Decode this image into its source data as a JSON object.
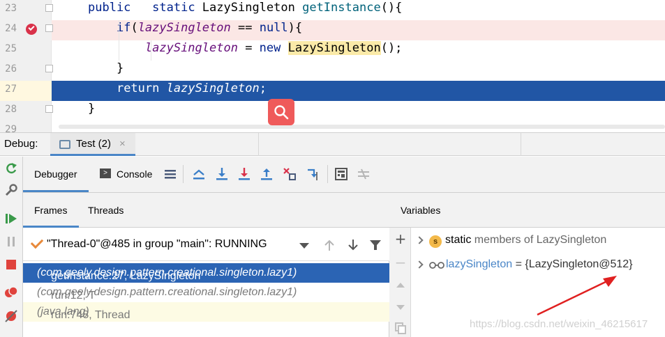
{
  "editor": {
    "lines": [
      {
        "num": "23",
        "parts": [
          [
            "kw",
            "public"
          ],
          [
            "",
            "   "
          ],
          [
            "kw",
            "static"
          ],
          [
            "",
            " LazySingleton "
          ],
          [
            "meth",
            "getInstance"
          ],
          [
            "",
            "(){"
          ]
        ]
      },
      {
        "num": "24",
        "parts": [
          [
            "",
            "    "
          ],
          [
            "kw",
            "if"
          ],
          [
            "",
            "("
          ],
          [
            "var",
            "lazySingleton"
          ],
          [
            "",
            " == "
          ],
          [
            "kw",
            "null"
          ],
          [
            "",
            "){"
          ]
        ]
      },
      {
        "num": "25",
        "parts": [
          [
            "",
            "        "
          ],
          [
            "var",
            "lazySingleton"
          ],
          [
            "",
            " = "
          ],
          [
            "kw",
            "new"
          ],
          [
            "",
            " "
          ],
          [
            "hl",
            "LazySingleton"
          ],
          [
            "",
            "();"
          ]
        ]
      },
      {
        "num": "26",
        "parts": [
          [
            "",
            "    }"
          ]
        ]
      },
      {
        "num": "27",
        "parts": [
          [
            "",
            "    "
          ],
          [
            "kw",
            "return"
          ],
          [
            "",
            " "
          ],
          [
            "var",
            "lazySingleton"
          ],
          [
            "",
            ";"
          ]
        ]
      },
      {
        "num": "28",
        "parts": [
          [
            "",
            "}"
          ]
        ]
      },
      {
        "num": "29",
        "parts": []
      }
    ],
    "breakpoint_line": "24",
    "execution_line": "27"
  },
  "debug": {
    "label": "Debug:",
    "session_tab": "Test (2)",
    "session_close": "×",
    "tabs": {
      "debugger": "Debugger",
      "console": "Console"
    }
  },
  "frames": {
    "tabs": {
      "frames": "Frames",
      "threads": "Threads"
    },
    "thread": "\"Thread-0\"@485 in group \"main\": RUNNING",
    "items": [
      {
        "method": "getInstance:27, LazySingleton ",
        "pkg": "(com.geely.design.pattern.creational.singleton.lazy1)"
      },
      {
        "method": "run:12, T ",
        "pkg": "(com.geely.design.pattern.creational.singleton.lazy1)"
      },
      {
        "method": "run:748, Thread ",
        "pkg": "(java.lang)"
      }
    ]
  },
  "variables": {
    "title": "Variables",
    "static_kw": "static",
    "static_rest": " members of LazySingleton",
    "static_badge": "s",
    "var_name": "lazySingleton",
    "var_value": " = {LazySingleton@512}"
  },
  "watermark": "https://blog.csdn.net/weixin_46215617",
  "colors": {
    "selection": "#2156a5",
    "breakpoint_bg": "#fbe7e5",
    "search_badge": "#ef5a5a",
    "arrow": "#e02020"
  }
}
